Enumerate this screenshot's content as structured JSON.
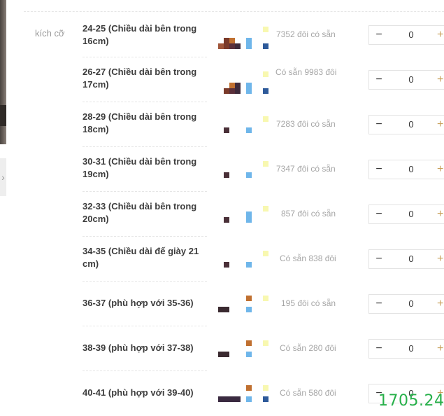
{
  "size_label": "kích cỡ",
  "rows": [
    {
      "name": "24-25 (Chiều dài bên trong 16cm)",
      "stock": "7352 đôi có sẵn",
      "qty": "0"
    },
    {
      "name": "26-27 (Chiều dài bên trong 17cm)",
      "stock": "Có sẵn 9983 đôi",
      "qty": "0"
    },
    {
      "name": "28-29 (Chiều dài bên trong 18cm)",
      "stock": "7283 đôi có sẵn",
      "qty": "0"
    },
    {
      "name": "30-31 (Chiều dài bên trong 19cm)",
      "stock": "7347 đôi có sẵn",
      "qty": "0"
    },
    {
      "name": "32-33 (Chiều dài bên trong 20cm)",
      "stock": "857 đôi có sẵn",
      "qty": "0"
    },
    {
      "name": "34-35 (Chiều dài đế giày 21 cm)",
      "stock": "Có sẵn 838 đôi",
      "qty": "0"
    },
    {
      "name": "36-37 (phù hợp với 35-36)",
      "stock": "195 đôi có sẵn",
      "qty": "0"
    },
    {
      "name": "38-39 (phù hợp với 37-38)",
      "stock": "Có sẵn 280 đôi",
      "qty": "0"
    },
    {
      "name": "40-41 (phù hợp với 39-40)",
      "stock": "Có sẵn 580 đôi",
      "qty": "0"
    }
  ],
  "minus_symbol": "−",
  "plus_symbol": "+",
  "side_arrow_icon": "chevron-right-icon",
  "watermark": "1705.24",
  "colors": {
    "swatch_brown": "#7a3a2a",
    "swatch_orange": "#c07030",
    "swatch_dark": "#4a3038",
    "swatch_blue": "#6fb6ea",
    "swatch_navy": "#2e5a9a",
    "swatch_yellow": "#f8f8b0",
    "watermark": "#27b04a"
  }
}
